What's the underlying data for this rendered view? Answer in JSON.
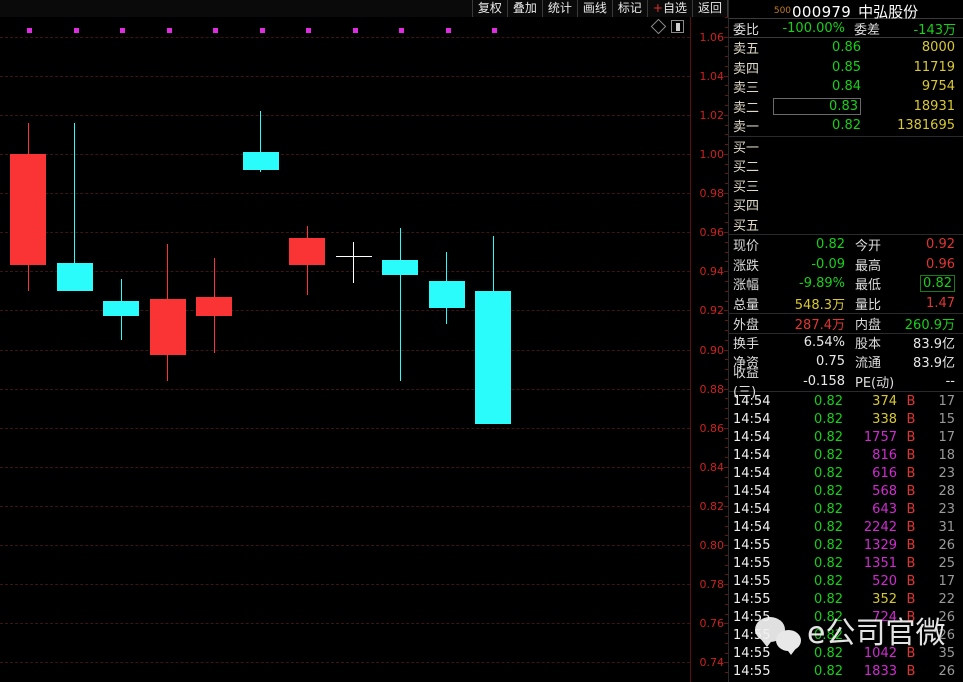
{
  "toolbar": {
    "buttons": [
      {
        "label": "复权",
        "name": "fuquan"
      },
      {
        "label": "叠加",
        "name": "diejia"
      },
      {
        "label": "统计",
        "name": "tongji"
      },
      {
        "label": "画线",
        "name": "huaxian"
      },
      {
        "label": "标记",
        "name": "biaoji"
      },
      {
        "label": "+自选",
        "name": "add-watchlist"
      },
      {
        "label": "返回",
        "name": "back"
      }
    ]
  },
  "chart_icons": [
    {
      "name": "diamond-icon"
    },
    {
      "name": "rect-toggle-icon"
    }
  ],
  "quote": {
    "code_sup": "500",
    "code": "000979",
    "name": "中弘股份",
    "weibi_label": "委比",
    "weibi_value": "-100.00%",
    "weicha_label": "委差",
    "weicha_value": "-143万"
  },
  "asks": [
    {
      "label": "卖五",
      "price": "0.86",
      "volume": "8000",
      "boxed": false
    },
    {
      "label": "卖四",
      "price": "0.85",
      "volume": "11719",
      "boxed": false
    },
    {
      "label": "卖三",
      "price": "0.84",
      "volume": "9754",
      "boxed": false
    },
    {
      "label": "卖二",
      "price": "0.83",
      "volume": "18931",
      "boxed": true
    },
    {
      "label": "卖一",
      "price": "0.82",
      "volume": "1381695",
      "boxed": false
    }
  ],
  "bids": [
    {
      "label": "买一",
      "price": "",
      "volume": ""
    },
    {
      "label": "买二",
      "price": "",
      "volume": ""
    },
    {
      "label": "买三",
      "price": "",
      "volume": ""
    },
    {
      "label": "买四",
      "price": "",
      "volume": ""
    },
    {
      "label": "买五",
      "price": "",
      "volume": ""
    }
  ],
  "stats": [
    {
      "l1": "现价",
      "v1": "0.82",
      "c1": "green",
      "box1": false,
      "l2": "今开",
      "v2": "0.92",
      "c2": "red",
      "box2": false
    },
    {
      "l1": "涨跌",
      "v1": "-0.09",
      "c1": "green",
      "box1": false,
      "l2": "最高",
      "v2": "0.96",
      "c2": "red",
      "box2": false
    },
    {
      "l1": "涨幅",
      "v1": "-9.89%",
      "c1": "green",
      "box1": false,
      "l2": "最低",
      "v2": "0.82",
      "c2": "green",
      "box2": true
    },
    {
      "l1": "总量",
      "v1": "548.3万",
      "c1": "yellow",
      "box1": false,
      "l2": "量比",
      "v2": "1.47",
      "c2": "red",
      "box2": false
    },
    {
      "l1": "外盘",
      "v1": "287.4万",
      "c1": "red",
      "box1": false,
      "l2": "内盘",
      "v2": "260.9万",
      "c2": "green",
      "box2": false
    },
    {
      "l1": "换手",
      "v1": "6.54%",
      "c1": "white",
      "box1": false,
      "l2": "股本",
      "v2": "83.9亿",
      "c2": "white",
      "box2": false
    },
    {
      "l1": "净资",
      "v1": "0.75",
      "c1": "white",
      "box1": false,
      "l2": "流通",
      "v2": "83.9亿",
      "c2": "white",
      "box2": false
    },
    {
      "l1": "收益(三)",
      "v1": "-0.158",
      "c1": "white",
      "box1": false,
      "l2": "PE(动)",
      "v2": "--",
      "c2": "white",
      "box2": false
    }
  ],
  "stat_separators": [
    4,
    5
  ],
  "ticks": [
    {
      "time": "14:54",
      "price": "0.82",
      "volume": "374",
      "vcolor": "v-y",
      "bs": "B",
      "count": "17"
    },
    {
      "time": "14:54",
      "price": "0.82",
      "volume": "338",
      "vcolor": "v-y",
      "bs": "B",
      "count": "15"
    },
    {
      "time": "14:54",
      "price": "0.82",
      "volume": "1757",
      "vcolor": "v-m",
      "bs": "B",
      "count": "17"
    },
    {
      "time": "14:54",
      "price": "0.82",
      "volume": "816",
      "vcolor": "v-m",
      "bs": "B",
      "count": "18"
    },
    {
      "time": "14:54",
      "price": "0.82",
      "volume": "616",
      "vcolor": "v-m",
      "bs": "B",
      "count": "23"
    },
    {
      "time": "14:54",
      "price": "0.82",
      "volume": "568",
      "vcolor": "v-m",
      "bs": "B",
      "count": "28"
    },
    {
      "time": "14:54",
      "price": "0.82",
      "volume": "643",
      "vcolor": "v-m",
      "bs": "B",
      "count": "23"
    },
    {
      "time": "14:54",
      "price": "0.82",
      "volume": "2242",
      "vcolor": "v-m",
      "bs": "B",
      "count": "31"
    },
    {
      "time": "14:55",
      "price": "0.82",
      "volume": "1329",
      "vcolor": "v-m",
      "bs": "B",
      "count": "26"
    },
    {
      "time": "14:55",
      "price": "0.82",
      "volume": "1351",
      "vcolor": "v-m",
      "bs": "B",
      "count": "25"
    },
    {
      "time": "14:55",
      "price": "0.82",
      "volume": "520",
      "vcolor": "v-m",
      "bs": "B",
      "count": "17"
    },
    {
      "time": "14:55",
      "price": "0.82",
      "volume": "352",
      "vcolor": "v-y",
      "bs": "B",
      "count": "22"
    },
    {
      "time": "14:55",
      "price": "0.82",
      "volume": "724",
      "vcolor": "v-m",
      "bs": "B",
      "count": "26"
    },
    {
      "time": "14:55",
      "price": "0.82",
      "volume": "",
      "vcolor": "v-m",
      "bs": "",
      "count": "26"
    },
    {
      "time": "14:55",
      "price": "0.82",
      "volume": "1042",
      "vcolor": "v-m",
      "bs": "B",
      "count": "35"
    },
    {
      "time": "14:55",
      "price": "0.82",
      "volume": "1833",
      "vcolor": "v-m",
      "bs": "B",
      "count": "26"
    }
  ],
  "watermark": {
    "text": "e公司官微"
  },
  "chart_data": {
    "type": "candlestick",
    "title": "000979 中弘股份",
    "ylabel": "",
    "ylim": [
      0.73,
      1.07
    ],
    "ytick_step": 0.02,
    "ytick_labels": [
      "1.06",
      "1.04",
      "1.02",
      "1.00",
      "0.98",
      "0.96",
      "0.94",
      "0.92",
      "0.90",
      "0.88",
      "0.86",
      "0.84",
      "0.82",
      "0.80",
      "0.78",
      "0.76",
      "0.74"
    ],
    "grid": true,
    "up_color": "#2afcfc",
    "down_color": "#fa3434",
    "doji_color": "#ffffff",
    "marker_color": "#e02ce0",
    "marker_count": 11,
    "candles": [
      {
        "index": 0,
        "open": 1.0,
        "high": 1.016,
        "low": 0.93,
        "close": 0.943,
        "dir": "down"
      },
      {
        "index": 1,
        "open": 0.944,
        "high": 1.016,
        "low": 0.944,
        "close": 0.93,
        "dir": "up"
      },
      {
        "index": 2,
        "open": 0.925,
        "high": 0.936,
        "low": 0.905,
        "close": 0.917,
        "dir": "up"
      },
      {
        "index": 3,
        "open": 0.926,
        "high": 0.954,
        "low": 0.884,
        "close": 0.897,
        "dir": "down"
      },
      {
        "index": 4,
        "open": 0.927,
        "high": 0.947,
        "low": 0.898,
        "close": 0.917,
        "dir": "down"
      },
      {
        "index": 5,
        "open": 1.001,
        "high": 1.022,
        "low": 0.991,
        "close": 0.992,
        "dir": "up"
      },
      {
        "index": 6,
        "open": 0.957,
        "high": 0.963,
        "low": 0.928,
        "close": 0.943,
        "dir": "down"
      },
      {
        "index": 7,
        "open": 0.948,
        "high": 0.955,
        "low": 0.934,
        "close": 0.948,
        "dir": "doji"
      },
      {
        "index": 8,
        "open": 0.946,
        "high": 0.962,
        "low": 0.884,
        "close": 0.938,
        "dir": "up"
      },
      {
        "index": 9,
        "open": 0.935,
        "high": 0.95,
        "low": 0.913,
        "close": 0.921,
        "dir": "up"
      },
      {
        "index": 10,
        "open": 0.93,
        "high": 0.958,
        "low": 0.862,
        "close": 0.862,
        "dir": "up"
      }
    ]
  }
}
